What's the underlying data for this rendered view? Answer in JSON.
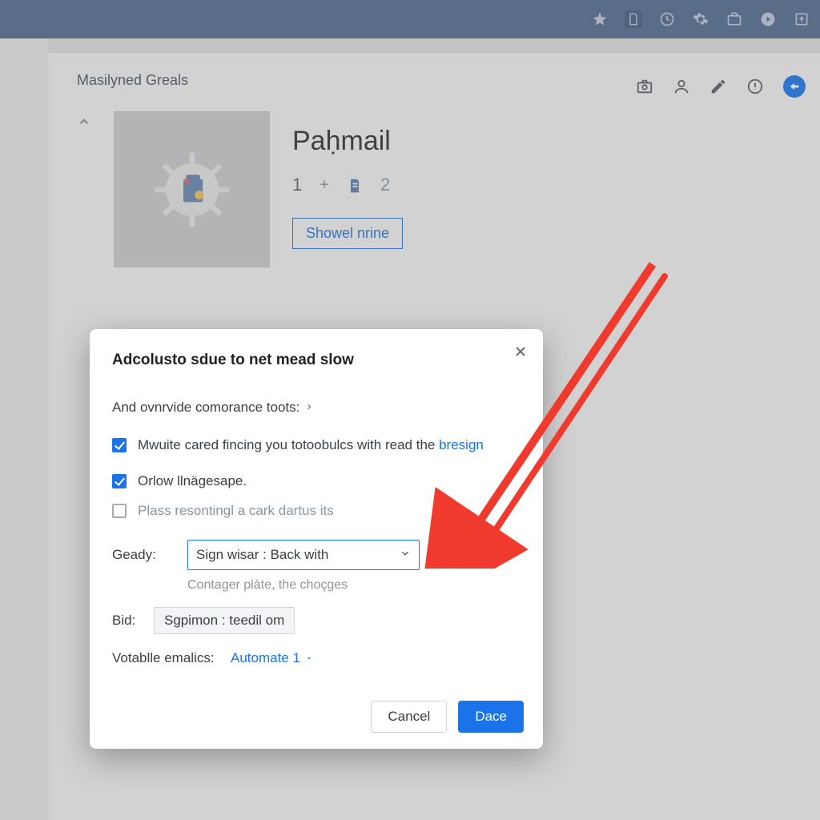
{
  "page": {
    "title": "Masilyned Greals",
    "app_name": "Paḥmail",
    "stat_1": "1",
    "stat_plus": "+",
    "stat_2": "2",
    "showel_label": "Showel nrine"
  },
  "dialog": {
    "title": "Adcolusto sdue to net mead slow",
    "subtitle": "And ovnrvide comorance toots:",
    "opt1_text": "Mwuite cared fincing you totoobulcs with read the ",
    "opt1_link": "bresign",
    "opt2_text": "Orlow llnägesape.",
    "opt3_text": "Plass resontingl a cark dartus its",
    "geady_label": "Geady:",
    "geady_value": "Sign wisar : Back with",
    "helper": "Contager plàte, the choçges",
    "bid_label": "Bid:",
    "bid_value": "Sgpimon : teedil om",
    "votable_label": "Votablle emalics:",
    "votable_value": "Automate 1",
    "cancel": "Cancel",
    "confirm": "Dace"
  }
}
